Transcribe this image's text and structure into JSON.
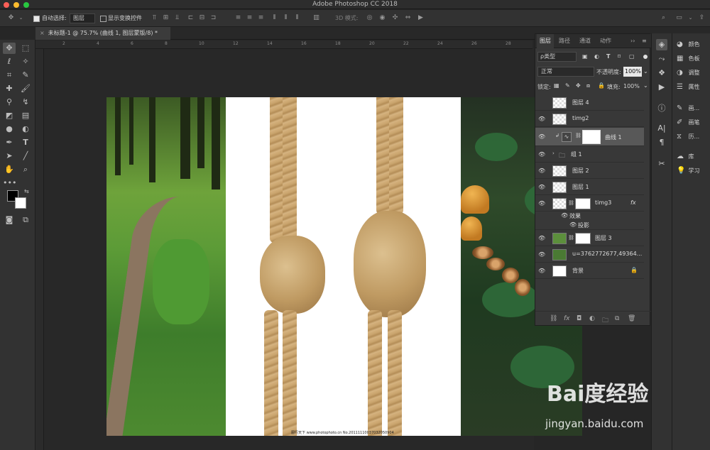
{
  "window": {
    "title": "Adobe Photoshop CC 2018"
  },
  "options_bar": {
    "auto_select_label": "自动选择:",
    "auto_select_value": "图层",
    "show_transform_label": "显示变换控件",
    "mode_3d_label": "3D 模式:"
  },
  "document_tab": {
    "title": "未标题-1 @ 75.7% (曲线 1, 图层蒙版/8) *"
  },
  "ruler": {
    "ticks": [
      "2",
      "4",
      "6",
      "8",
      "10",
      "12",
      "14",
      "16",
      "18",
      "20",
      "22",
      "24",
      "26",
      "28"
    ]
  },
  "canvas": {
    "stock_credit": "图行天下 www.photophoto.cn  No.20111110037032050904"
  },
  "layers_panel": {
    "tabs": [
      "图层",
      "路径",
      "通道",
      "动作"
    ],
    "filter_kind": "ρ类型",
    "blend_mode": "正常",
    "opacity_label": "不透明度:",
    "opacity_value": "100%",
    "lock_label": "锁定:",
    "fill_label": "填充:",
    "fill_value": "100%",
    "layers": [
      {
        "name": "图层 4",
        "visible": false
      },
      {
        "name": "timg2",
        "visible": true
      },
      {
        "name": "曲线 1",
        "visible": true,
        "selected": true
      },
      {
        "name": "组 1",
        "visible": true
      },
      {
        "name": "图层 2",
        "visible": true
      },
      {
        "name": "图层 1",
        "visible": true
      },
      {
        "name": "timg3",
        "visible": true,
        "fx": "fx"
      },
      {
        "name": "效果",
        "visible": true
      },
      {
        "name": "投影",
        "visible": true
      },
      {
        "name": "图层 3",
        "visible": true
      },
      {
        "name": "u=3762772677,49364...",
        "visible": true
      },
      {
        "name": "背景",
        "visible": true
      }
    ]
  },
  "right_panels": {
    "items": [
      {
        "label": "颜色",
        "icon": "color-wheel-icon"
      },
      {
        "label": "色板",
        "icon": "swatches-icon"
      },
      {
        "label": "调整",
        "icon": "adjustments-icon"
      },
      {
        "label": "属性",
        "icon": "properties-icon"
      },
      {
        "label": "画...",
        "icon": "brush-icon"
      },
      {
        "label": "画笔",
        "icon": "brush-settings-icon"
      },
      {
        "label": "历...",
        "icon": "history-icon"
      },
      {
        "label": "库",
        "icon": "libraries-icon"
      },
      {
        "label": "学习",
        "icon": "learn-icon"
      }
    ]
  },
  "watermark": {
    "logo": "Bai度经验",
    "url": "jingyan.baidu.com"
  }
}
